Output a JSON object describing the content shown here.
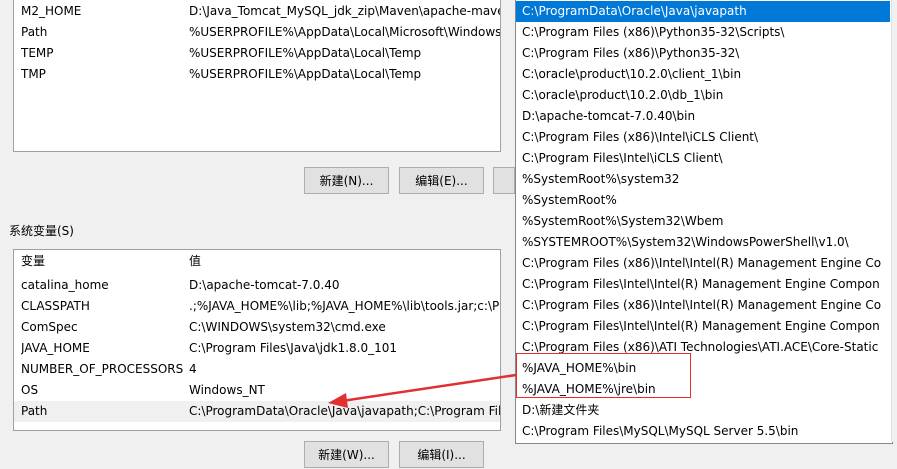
{
  "user_vars": {
    "rows": [
      {
        "name": "M2_HOME",
        "value": "D:\\Java_Tomcat_MySQL_jdk_zip\\Maven\\apache-mave"
      },
      {
        "name": "Path",
        "value": "%USERPROFILE%\\AppData\\Local\\Microsoft\\Windows"
      },
      {
        "name": "TEMP",
        "value": "%USERPROFILE%\\AppData\\Local\\Temp"
      },
      {
        "name": "TMP",
        "value": "%USERPROFILE%\\AppData\\Local\\Temp"
      }
    ],
    "new_button": "新建(N)...",
    "edit_button": "编辑(E)..."
  },
  "system_vars": {
    "section_label": "系统变量(S)",
    "col_name": "变量",
    "col_value": "值",
    "rows": [
      {
        "name": "catalina_home",
        "value": "D:\\apache-tomcat-7.0.40"
      },
      {
        "name": "CLASSPATH",
        "value": ".;%JAVA_HOME%\\lib;%JAVA_HOME%\\lib\\tools.jar;c:\\P"
      },
      {
        "name": "ComSpec",
        "value": "C:\\WINDOWS\\system32\\cmd.exe"
      },
      {
        "name": "JAVA_HOME",
        "value": "C:\\Program Files\\Java\\jdk1.8.0_101"
      },
      {
        "name": "NUMBER_OF_PROCESSORS",
        "value": "4"
      },
      {
        "name": "OS",
        "value": "Windows_NT"
      },
      {
        "name": "Path",
        "value": "C:\\ProgramData\\Oracle\\Java\\javapath;C:\\Program Fil"
      }
    ],
    "new_button": "新建(W)...",
    "edit_button": "编辑(I)..."
  },
  "path_entries": [
    "C:\\ProgramData\\Oracle\\Java\\javapath",
    "C:\\Program Files (x86)\\Python35-32\\Scripts\\",
    "C:\\Program Files (x86)\\Python35-32\\",
    "C:\\oracle\\product\\10.2.0\\client_1\\bin",
    "C:\\oracle\\product\\10.2.0\\db_1\\bin",
    "D:\\apache-tomcat-7.0.40\\bin",
    "C:\\Program Files (x86)\\Intel\\iCLS Client\\",
    "C:\\Program Files\\Intel\\iCLS Client\\",
    "%SystemRoot%\\system32",
    "%SystemRoot%",
    "%SystemRoot%\\System32\\Wbem",
    "%SYSTEMROOT%\\System32\\WindowsPowerShell\\v1.0\\",
    "C:\\Program Files (x86)\\Intel\\Intel(R) Management Engine Co",
    "C:\\Program Files\\Intel\\Intel(R) Management Engine Compon",
    "C:\\Program Files (x86)\\Intel\\Intel(R) Management Engine Co",
    "C:\\Program Files\\Intel\\Intel(R) Management Engine Compon",
    "C:\\Program Files (x86)\\ATI Technologies\\ATI.ACE\\Core-Static",
    "%JAVA_HOME%\\bin",
    "%JAVA_HOME%\\jre\\bin",
    "D:\\新建文件夹",
    "C:\\Program Files\\MySQL\\MySQL Server 5.5\\bin"
  ],
  "colors": {
    "selection": "#0078d7",
    "annotation": "#e03030"
  }
}
